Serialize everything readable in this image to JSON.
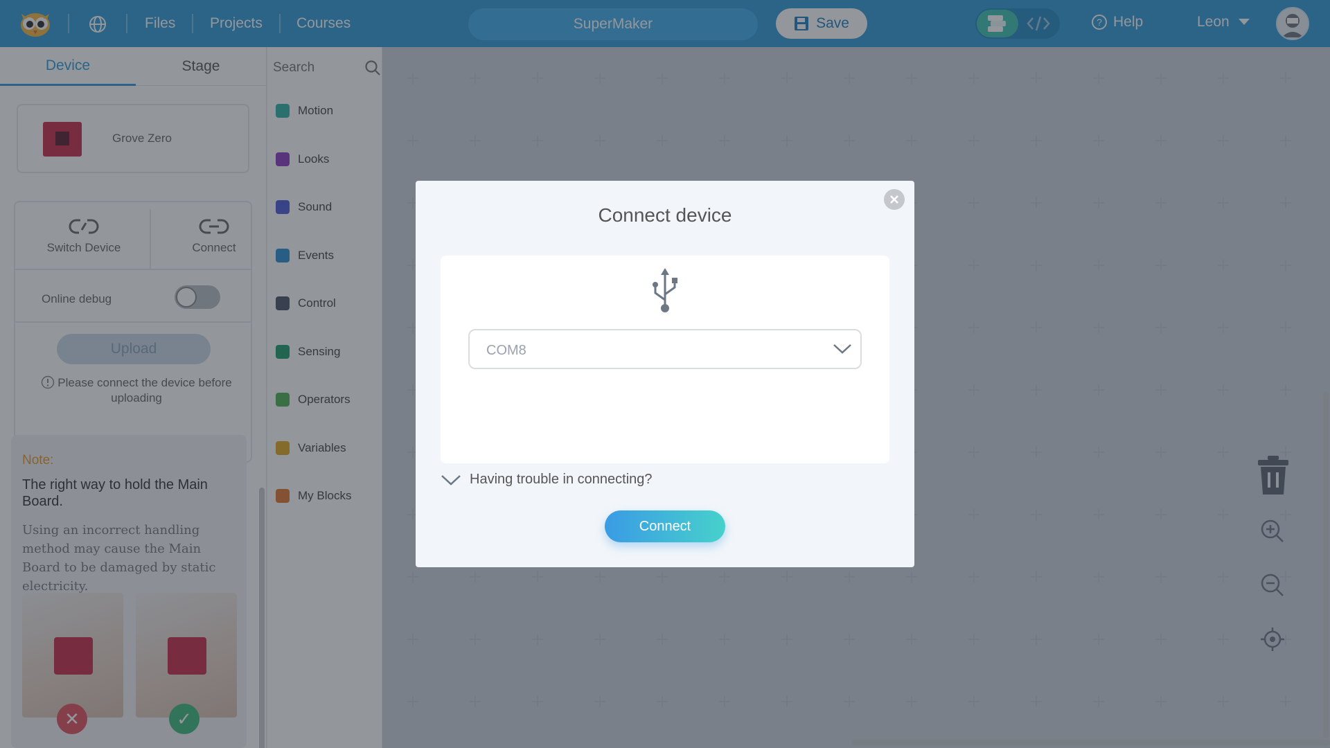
{
  "topbar": {
    "nav": [
      "Files",
      "Projects",
      "Courses"
    ],
    "project_name": "SuperMaker",
    "save_label": "Save",
    "help_label": "Help",
    "user_name": "Leon"
  },
  "left_panel": {
    "tabs": [
      "Device",
      "Stage"
    ],
    "active_tab": "Device",
    "device_name": "Grove Zero",
    "switch_device_label": "Switch Device",
    "connect_label": "Connect",
    "online_debug_label": "Online debug",
    "upload_label": "Upload",
    "upload_hint": "Please connect the device before uploading",
    "note": {
      "title": "Note:",
      "heading": "The right way to hold the Main Board.",
      "body": "Using an incorrect handling method may cause the Main Board to be damaged by static electricity."
    }
  },
  "categories": {
    "search_placeholder": "Search",
    "items": [
      {
        "label": "Motion",
        "color": "#2fb0a6"
      },
      {
        "label": "Looks",
        "color": "#8a3bc2"
      },
      {
        "label": "Sound",
        "color": "#4a5ad8"
      },
      {
        "label": "Events",
        "color": "#2a8fd0"
      },
      {
        "label": "Control",
        "color": "#4a5568"
      },
      {
        "label": "Sensing",
        "color": "#1a9c6a"
      },
      {
        "label": "Operators",
        "color": "#4caf50"
      },
      {
        "label": "Variables",
        "color": "#e0a81f"
      },
      {
        "label": "My Blocks",
        "color": "#e0762f"
      }
    ]
  },
  "modal": {
    "title": "Connect device",
    "port_value": "COM8",
    "trouble_label": "Having trouble in connecting?",
    "connect_label": "Connect"
  },
  "colors": {
    "topbar": "#2f9bd6",
    "accent": "#2f9bd6",
    "connect_gradient_start": "#3a9be4",
    "connect_gradient_end": "#47d1cc"
  }
}
